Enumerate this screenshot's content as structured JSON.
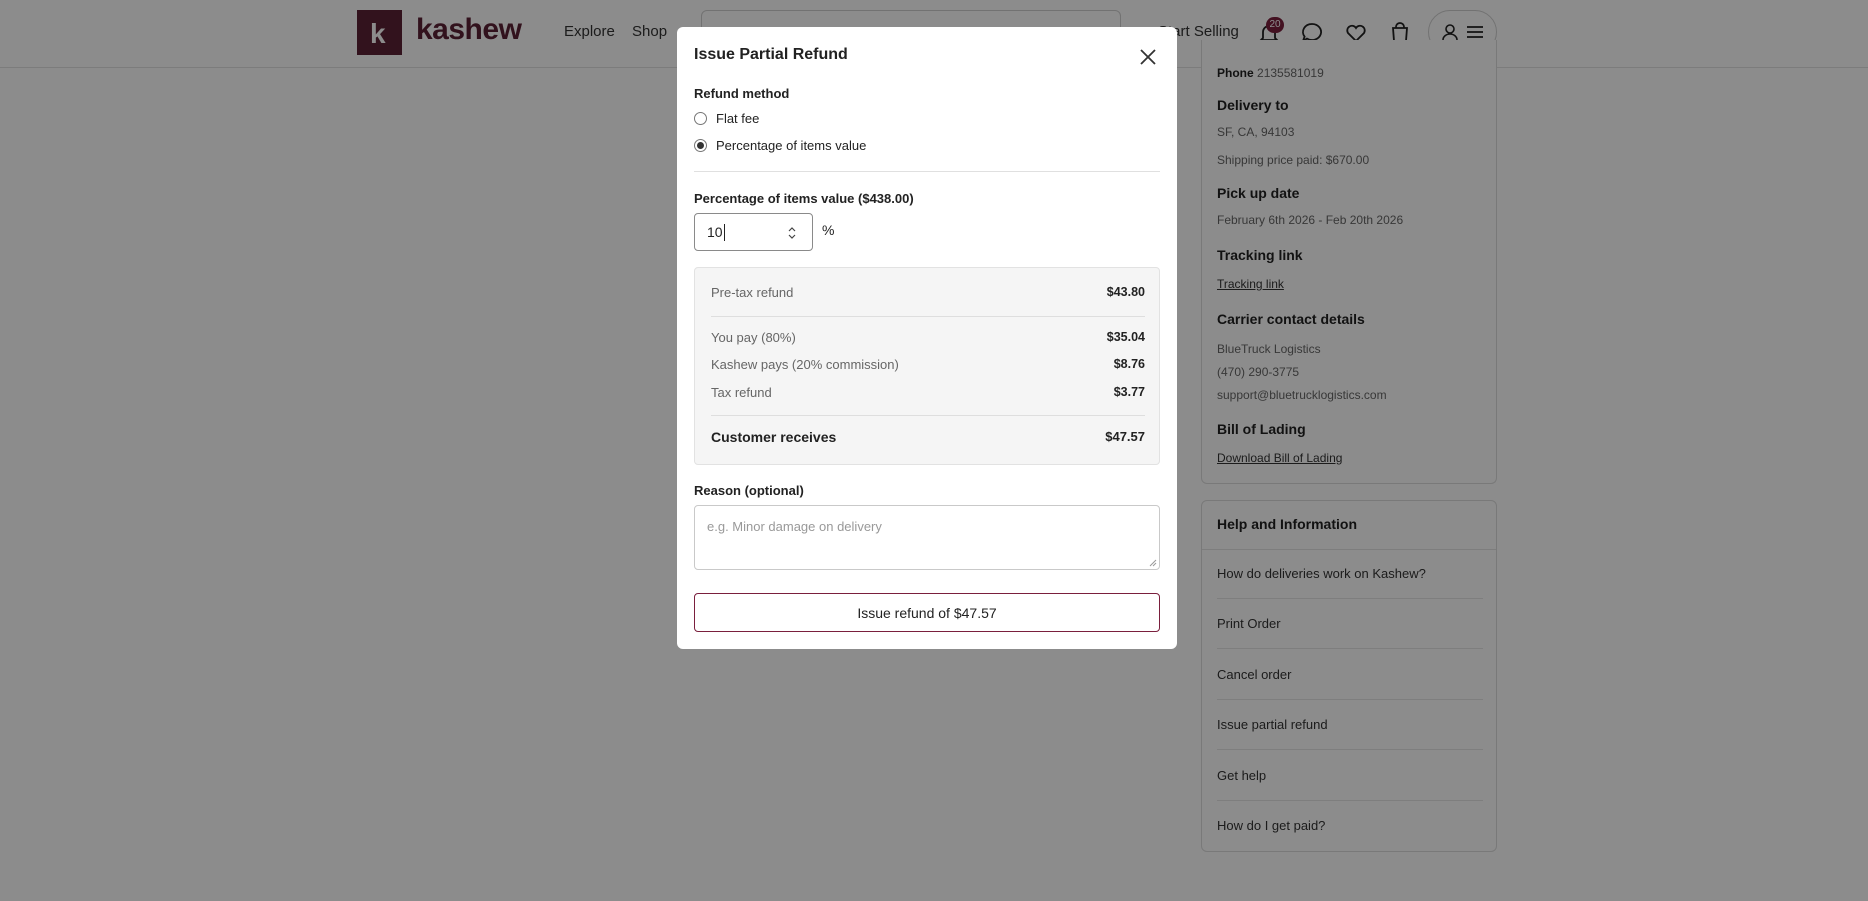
{
  "header": {
    "logo_letter": "k",
    "logo_text": "kashew",
    "nav": [
      "Explore",
      "Shop"
    ],
    "start_selling": "Start Selling",
    "notification_count": "20",
    "brand_color": "#5b2136"
  },
  "order_details": {
    "phone_label": "Phone",
    "phone_value": "2135581019",
    "delivery_to_label": "Delivery to",
    "delivery_address": "SF, CA, 94103",
    "shipping_price": "Shipping price paid: $670.00",
    "pickup_label": "Pick up date",
    "pickup_value": "February 6th 2026 - Feb 20th 2026",
    "tracking_label": "Tracking link",
    "tracking_link": "Tracking link",
    "carrier_label": "Carrier contact details",
    "carrier_name": "BlueTruck Logistics",
    "carrier_phone": "(470) 290-3775",
    "carrier_email": "support@bluetrucklogistics.com",
    "bol_label": "Bill of Lading",
    "bol_link": "Download Bill of Lading"
  },
  "help": {
    "title": "Help and Information",
    "items": [
      "How do deliveries work on Kashew?",
      "Print Order",
      "Cancel order",
      "Issue partial refund",
      "Get help",
      "How do I get paid?"
    ]
  },
  "modal": {
    "title": "Issue Partial Refund",
    "refund_method_label": "Refund method",
    "options": [
      {
        "label": "Flat fee",
        "checked": false
      },
      {
        "label": "Percentage of items value",
        "checked": true
      }
    ],
    "percentage_label": "Percentage of items value ($438.00)",
    "percentage_value": "10",
    "unit": "%",
    "summary": {
      "pretax_label": "Pre-tax refund",
      "pretax_value": "$43.80",
      "you_pay_label": "You pay (80%)",
      "you_pay_value": "$35.04",
      "kashew_pays_label": "Kashew pays (20% commission)",
      "kashew_pays_value": "$8.76",
      "tax_label": "Tax refund",
      "tax_value": "$3.77",
      "customer_label": "Customer receives",
      "customer_value": "$47.57"
    },
    "reason_label": "Reason (optional)",
    "reason_placeholder": "e.g. Minor damage on delivery",
    "submit_label": "Issue refund of $47.57"
  }
}
